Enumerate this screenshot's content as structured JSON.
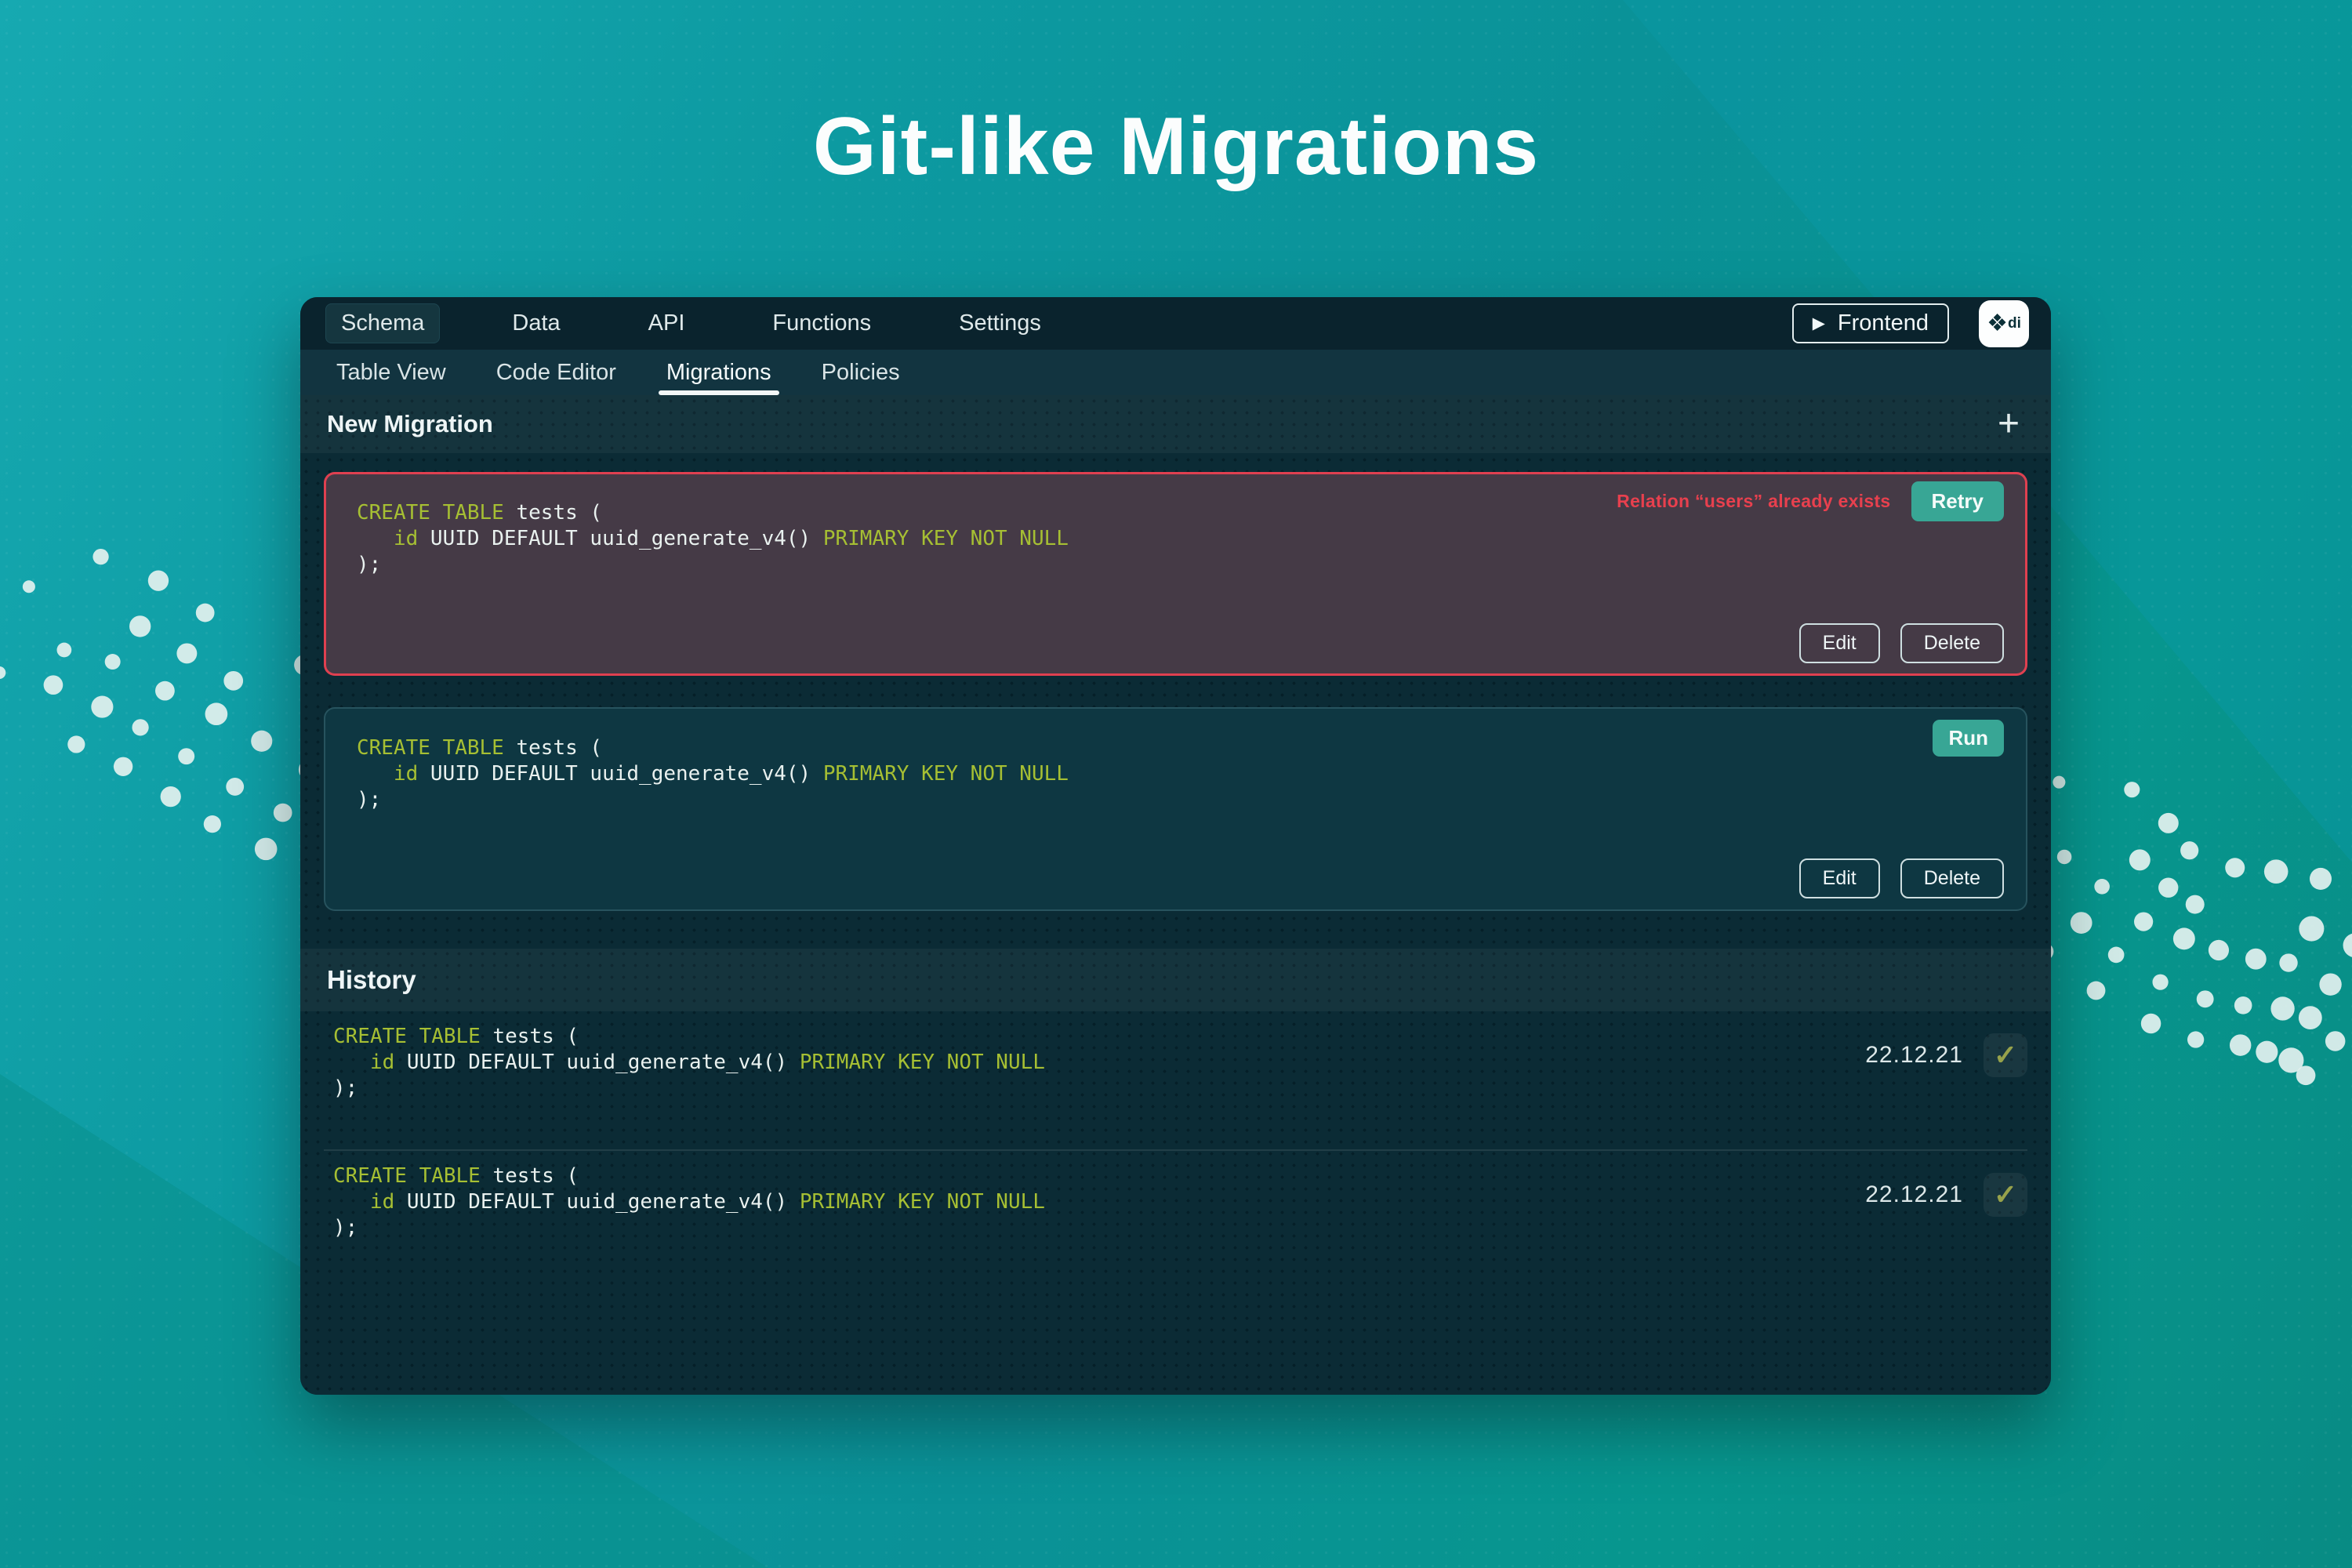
{
  "page": {
    "title": "Git-like Migrations"
  },
  "nav": {
    "items": [
      {
        "label": "Schema",
        "active": true
      },
      {
        "label": "Data",
        "active": false
      },
      {
        "label": "API",
        "active": false
      },
      {
        "label": "Functions",
        "active": false
      },
      {
        "label": "Settings",
        "active": false
      }
    ],
    "frontend_button": {
      "label": "Frontend"
    },
    "logo_button": {
      "text": "di"
    }
  },
  "subnav": {
    "items": [
      {
        "label": "Table View",
        "active": false
      },
      {
        "label": "Code Editor",
        "active": false
      },
      {
        "label": "Migrations",
        "active": true
      },
      {
        "label": "Policies",
        "active": false
      }
    ]
  },
  "new_migration": {
    "heading": "New Migration"
  },
  "migrations": [
    {
      "status": "error",
      "error_message": "Relation “users” already exists",
      "primary_action": "Retry",
      "edit_label": "Edit",
      "delete_label": "Delete",
      "sql": [
        [
          {
            "c": "k",
            "t": "CREATE TABLE"
          },
          {
            "c": "p",
            "t": " tests ("
          }
        ],
        [
          {
            "c": "p",
            "t": "   "
          },
          {
            "c": "k",
            "t": "id"
          },
          {
            "c": "p",
            "t": " UUID DEFAULT uuid_generate_v4() "
          },
          {
            "c": "k",
            "t": "PRIMARY KEY NOT NULL"
          }
        ],
        [
          {
            "c": "p",
            "t": ");"
          }
        ]
      ]
    },
    {
      "status": "ready",
      "primary_action": "Run",
      "edit_label": "Edit",
      "delete_label": "Delete",
      "sql": [
        [
          {
            "c": "k",
            "t": "CREATE TABLE"
          },
          {
            "c": "p",
            "t": " tests ("
          }
        ],
        [
          {
            "c": "p",
            "t": "   "
          },
          {
            "c": "k",
            "t": "id"
          },
          {
            "c": "p",
            "t": " UUID DEFAULT uuid_generate_v4() "
          },
          {
            "c": "k",
            "t": "PRIMARY KEY NOT NULL"
          }
        ],
        [
          {
            "c": "p",
            "t": ");"
          }
        ]
      ]
    }
  ],
  "history": {
    "heading": "History",
    "entries": [
      {
        "date": "22.12.21",
        "applied": true,
        "sql": [
          [
            {
              "c": "k",
              "t": "CREATE TABLE"
            },
            {
              "c": "p",
              "t": " tests ("
            }
          ],
          [
            {
              "c": "p",
              "t": "   "
            },
            {
              "c": "k",
              "t": "id"
            },
            {
              "c": "p",
              "t": " UUID DEFAULT uuid_generate_v4() "
            },
            {
              "c": "k",
              "t": "PRIMARY KEY NOT NULL"
            }
          ],
          [
            {
              "c": "p",
              "t": ");"
            }
          ]
        ]
      },
      {
        "date": "22.12.21",
        "applied": true,
        "sql": [
          [
            {
              "c": "k",
              "t": "CREATE TABLE"
            },
            {
              "c": "p",
              "t": " tests ("
            }
          ],
          [
            {
              "c": "p",
              "t": "   "
            },
            {
              "c": "k",
              "t": "id"
            },
            {
              "c": "p",
              "t": " UUID DEFAULT uuid_generate_v4() "
            },
            {
              "c": "k",
              "t": "PRIMARY KEY NOT NULL"
            }
          ],
          [
            {
              "c": "p",
              "t": ");"
            }
          ]
        ]
      }
    ]
  },
  "icons": {
    "play": "▶",
    "plus": "+",
    "check": "✓",
    "diamonds": "❖"
  },
  "colors": {
    "background_teal": "#0a9298",
    "panel_dark": "#0c2d38",
    "accent_button_teal": "#38a695",
    "error_red": "#e0414d",
    "sql_keyword_green": "#a6bf33",
    "sql_text": "#e9f1ef",
    "dot_wave_white": "#e3f1ef"
  }
}
